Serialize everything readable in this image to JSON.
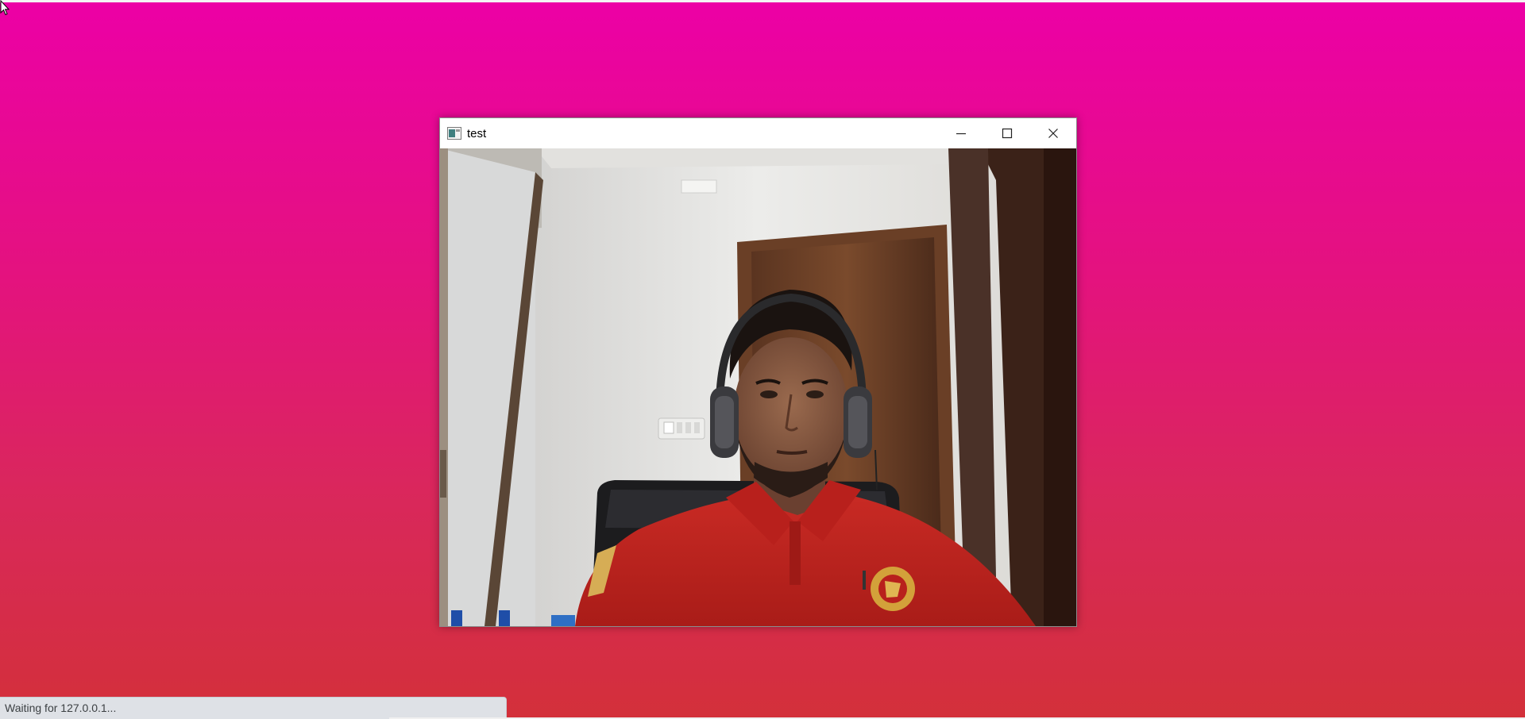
{
  "desktop": {
    "background_top": "#ec00a6",
    "background_bottom": "#d3303a"
  },
  "window": {
    "title": "test",
    "icon": "app-window-icon",
    "controls": {
      "minimize_icon": "minimize-icon",
      "maximize_icon": "maximize-icon",
      "close_icon": "close-icon"
    },
    "content": {
      "type": "webcam-frame",
      "description_icon": "camera-feed"
    }
  },
  "statusbar": {
    "text": "Waiting for 127.0.0.1..."
  }
}
